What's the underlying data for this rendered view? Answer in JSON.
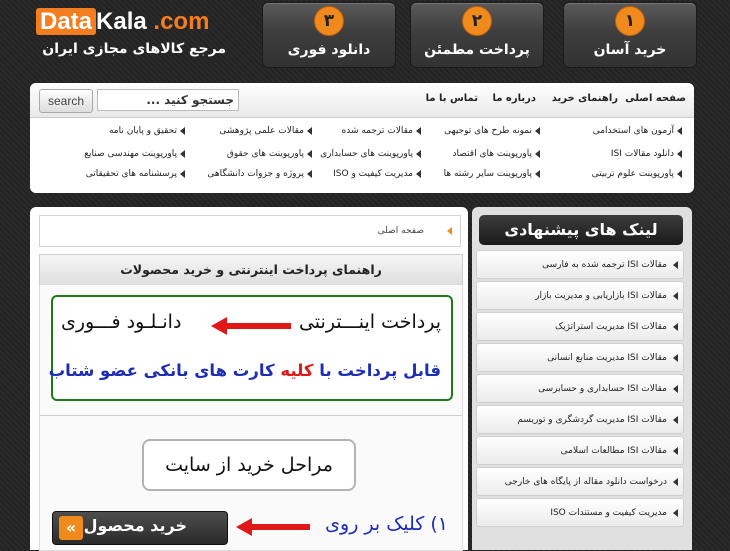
{
  "logo": {
    "part1": "Data",
    "part2": "Kala",
    "part3": ".com",
    "tagline": "مرجع کالاهای مجازی ایران"
  },
  "steps": [
    {
      "num": "۱",
      "label": "خرید آسان"
    },
    {
      "num": "۲",
      "label": "پرداخت مطمئن"
    },
    {
      "num": "۳",
      "label": "دانلود فوری"
    }
  ],
  "nav": {
    "menu": [
      "صفحه اصلی",
      "راهنمای خرید",
      "درباره ما",
      "تماس با ما"
    ],
    "search_button": "search",
    "search_placeholder": "جستجو کنید ...",
    "categories": [
      [
        "آزمون های استخدامی",
        "نمونه طرح های توجیهی",
        "مقالات ترجمه شده",
        "مقالات علمی پژوهشی",
        "تحقیق و پایان نامه"
      ],
      [
        "دانلود مقالات ISI",
        "پاورپوینت های اقتصاد",
        "پاورپوینت های حسابداری",
        "پاورپوینت های حقوق",
        "پاورپوینت مهندسی صنایع"
      ],
      [
        "پاورپوینت علوم تربیتی",
        "پاورپوینت سایر رشته ها",
        "مدیریت کیفیت و ISO",
        "پروژه و جزوات دانشگاهی",
        "پرسشنامه های تحقیقاتی"
      ]
    ]
  },
  "breadcrumb": "صفحه اصلی",
  "guide_title": "راهنمای پرداخت اینترنتی و خرید محصولات",
  "promo": {
    "line1_a": "پرداخت اینـــترنتی",
    "line1_b": "دانـلـود فـــوری",
    "line2_a": "قابل پرداخت با",
    "line2_b": "کلیه",
    "line2_c": "کارت های بانکی عضو شتاب"
  },
  "steps_box": "مراحل خرید از سایت",
  "buy_button": "خرید محصول",
  "buy_chevron": "«",
  "click_text": "۱) کلیک بر روی",
  "sidebar": {
    "title": "لینک های پیشنهادی",
    "items": [
      "مقالات ISI ترجمه شده به فارسی",
      "مقالات ISI بازاریابی و مدیریت بازار",
      "مقالات ISI مدیریت استراتژیک",
      "مقالات ISI مدیریت منابع انسانی",
      "مقالات ISI حسابداری و حسابرسی",
      "مقالات ISI مدیریت گردشگری و توریسم",
      "مقالات ISI مطالعات اسلامی",
      "درخواست دانلود مقاله از پایگاه های خارجی",
      "مدیریت کیفیت و مستندات ISO"
    ]
  },
  "colors": {
    "accent": "#f08a1c",
    "green": "#1c7a1c",
    "red": "#e01818",
    "blue": "#1e2eb4"
  }
}
